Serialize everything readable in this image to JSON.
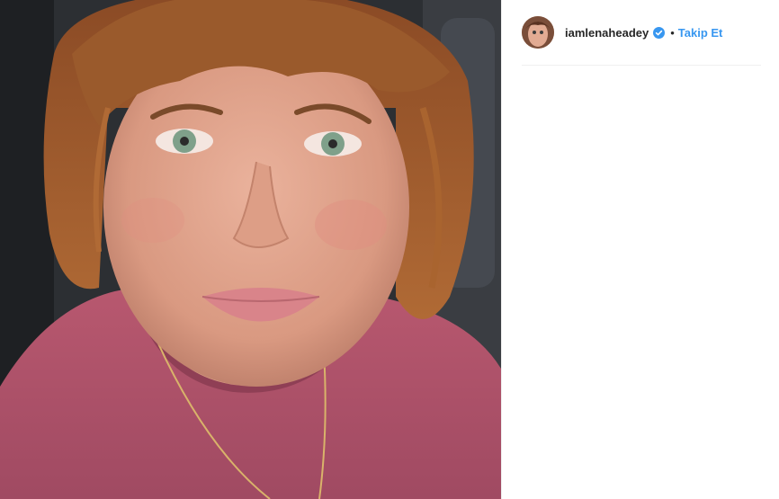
{
  "post": {
    "username": "iamlenaheadey",
    "separator": "•",
    "follow_label": "Takip Et",
    "verified_icon": "verified-badge-icon",
    "accent_color": "#3897f0"
  }
}
